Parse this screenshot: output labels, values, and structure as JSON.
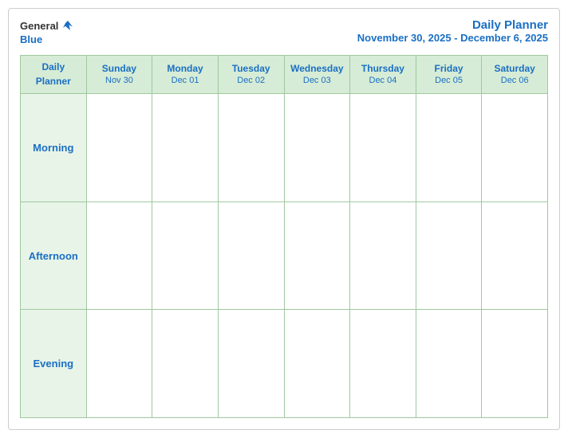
{
  "logo": {
    "general": "General",
    "blue": "Blue"
  },
  "header": {
    "title": "Daily Planner",
    "subtitle": "November 30, 2025 - December 6, 2025"
  },
  "table": {
    "col_header_label_line1": "Daily",
    "col_header_label_line2": "Planner",
    "columns": [
      {
        "day": "Sunday",
        "date": "Nov 30"
      },
      {
        "day": "Monday",
        "date": "Dec 01"
      },
      {
        "day": "Tuesday",
        "date": "Dec 02"
      },
      {
        "day": "Wednesday",
        "date": "Dec 03"
      },
      {
        "day": "Thursday",
        "date": "Dec 04"
      },
      {
        "day": "Friday",
        "date": "Dec 05"
      },
      {
        "day": "Saturday",
        "date": "Dec 06"
      }
    ],
    "rows": [
      {
        "label": "Morning"
      },
      {
        "label": "Afternoon"
      },
      {
        "label": "Evening"
      }
    ]
  }
}
